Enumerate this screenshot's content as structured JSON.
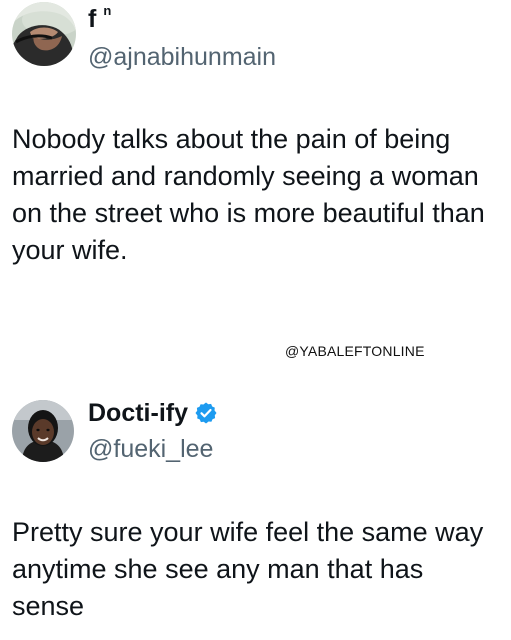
{
  "tweets": [
    {
      "display_name": "f",
      "display_name_sup": "n",
      "handle": "@ajnabihunmain",
      "verified": false,
      "text": "Nobody talks about the pain of being married and randomly seeing a woman on the street who is more beautiful than your wife."
    },
    {
      "display_name": "Docti-ify",
      "handle": "@fueki_lee",
      "verified": true,
      "text": "Pretty sure your wife feel the same way anytime she see any man that has sense"
    }
  ],
  "watermark": "@YABALEFTONLINE",
  "colors": {
    "text": "#0f1419",
    "handle": "#536471",
    "verified_badge": "#1d9bf0"
  },
  "icons": {
    "verified": "verified-badge-icon"
  }
}
